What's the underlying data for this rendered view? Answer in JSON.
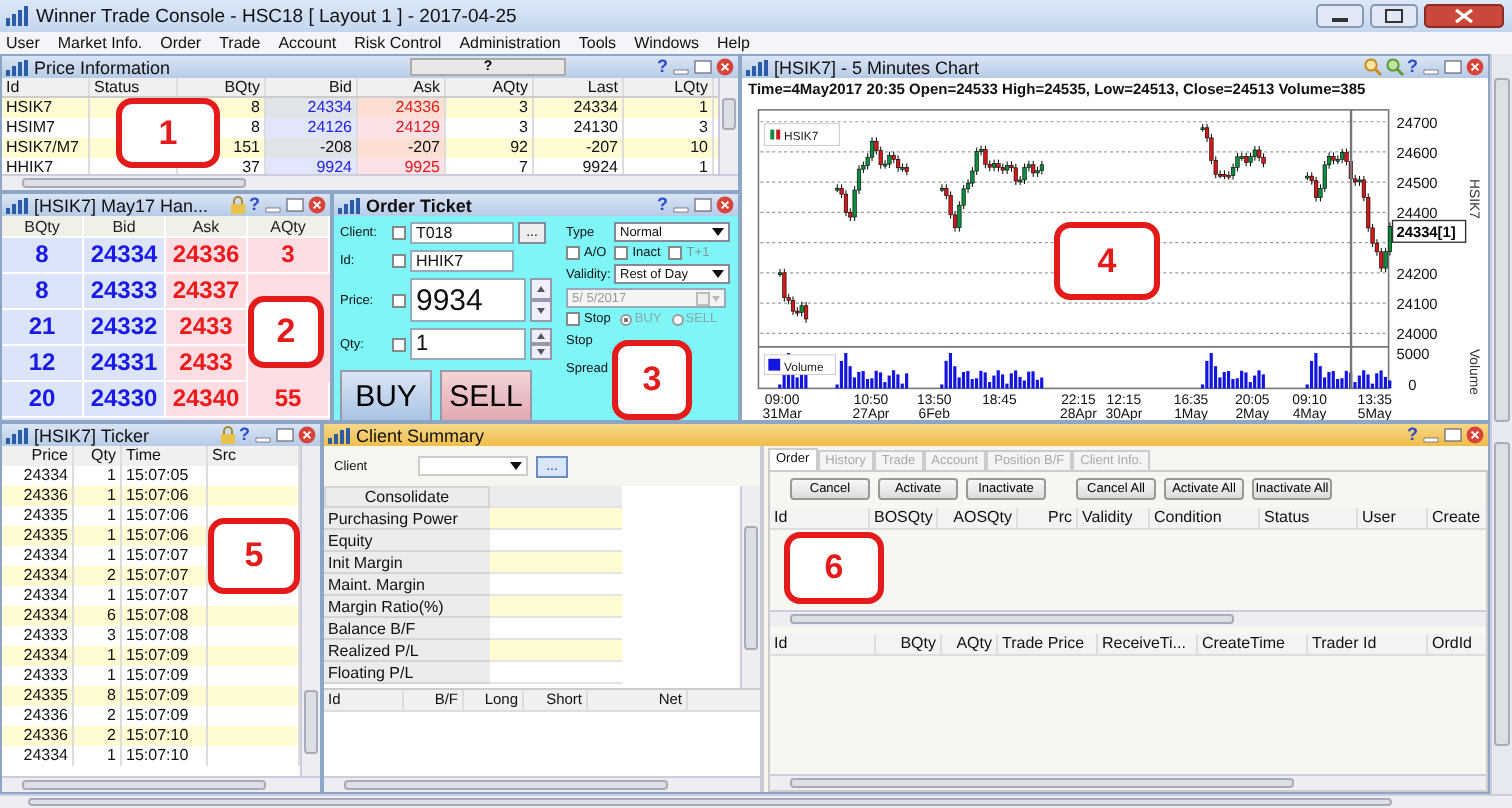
{
  "window": {
    "title": "Winner Trade Console - HSC18 [ Layout 1 ] - 2017-04-25"
  },
  "menu": [
    "User",
    "Market Info.",
    "Order",
    "Trade",
    "Account",
    "Risk Control",
    "Administration",
    "Tools",
    "Windows",
    "Help"
  ],
  "price_information": {
    "title": "Price Information",
    "help_button": "?",
    "help": "?",
    "columns": [
      "Id",
      "Status",
      "BQty",
      "Bid",
      "Ask",
      "AQty",
      "Last",
      "LQty"
    ],
    "rows": [
      {
        "kind": "outright",
        "id": "HSIK7",
        "bqty": "8",
        "bid": "24334",
        "ask": "24336",
        "aqty": "3",
        "last": "24334",
        "lqty": "1"
      },
      {
        "kind": "outright",
        "id": "HSIM7",
        "bqty": "8",
        "bid": "24126",
        "ask": "24129",
        "aqty": "3",
        "last": "24130",
        "lqty": "3"
      },
      {
        "kind": "spread",
        "id": "HSIK7/M7",
        "bqty": "151",
        "bid": "-208",
        "ask": "-207",
        "aqty": "92",
        "last": "-207",
        "lqty": "10"
      },
      {
        "kind": "outright",
        "id": "HHIK7",
        "bqty": "37",
        "bid": "9924",
        "ask": "9925",
        "aqty": "7",
        "last": "9924",
        "lqty": "1"
      }
    ]
  },
  "market_depth": {
    "title": "[HSIK7] May17 Han...",
    "help": "?",
    "columns": [
      "BQty",
      "Bid",
      "Ask",
      "AQty"
    ],
    "rows": [
      {
        "bqty": "8",
        "bid": "24334",
        "ask": "24336",
        "aqty": "3"
      },
      {
        "bqty": "8",
        "bid": "24333",
        "ask": "24337"
      },
      {
        "bqty": "21",
        "bid": "24332",
        "ask": "2433"
      },
      {
        "bqty": "12",
        "bid": "24331",
        "ask": "2433"
      },
      {
        "bqty": "20",
        "bid": "24330",
        "ask": "24340",
        "aqty": "55"
      }
    ]
  },
  "order_ticket": {
    "title": "Order Ticket",
    "help": "?",
    "client": {
      "label": "Client:",
      "value": "T018",
      "checked": false
    },
    "browse_button": "...",
    "id": {
      "label": "Id:",
      "value": "HHIK7",
      "checked": false
    },
    "price": {
      "label": "Price:",
      "value": "9934",
      "checked": false
    },
    "qty": {
      "label": "Qty:",
      "value": "1",
      "checked": false
    },
    "type": {
      "label": "Type",
      "value": "Normal"
    },
    "options": [
      {
        "label": "A/O",
        "checked": false,
        "disabled": false
      },
      {
        "label": "Inact",
        "checked": false,
        "disabled": false
      },
      {
        "label": "T+1",
        "checked": false,
        "disabled": true
      }
    ],
    "validity": {
      "label": "Validity:",
      "value": "Rest of Day"
    },
    "date": {
      "value": "5/ 5/2017",
      "disabled": true
    },
    "stop": {
      "label": "Stop",
      "checked": false
    },
    "sides": [
      {
        "label": "BUY",
        "selected": true,
        "disabled": true
      },
      {
        "label": "SELL",
        "selected": false,
        "disabled": true
      }
    ],
    "stop_label": "Stop",
    "spread_label": "Spread",
    "buy_button": "BUY",
    "sell_button": "SELL"
  },
  "chart": {
    "title": "[HSIK7] - 5 Minutes Chart",
    "help": "?",
    "info": "Time=4May2017 20:35 Open=24533 High=24535, Low=24513, Close=24513 Volume=385",
    "legend": "HSIK7",
    "volume_legend": "Volume",
    "price_ticks": [
      "24700",
      "24600",
      "24500",
      "24400",
      "24200",
      "24100",
      "24000"
    ],
    "volume_ticks": [
      "5000",
      "0"
    ],
    "time_labels": [
      {
        "time": "09:00",
        "date": "31Mar"
      },
      {
        "time": "10:50",
        "date": "27Apr"
      },
      {
        "time": "13:50",
        "date": "6Feb"
      },
      {
        "time": "18:45"
      },
      {
        "time": "22:15",
        "date": "28Apr"
      },
      {
        "time": "12:15",
        "date": "30Apr"
      },
      {
        "time": "16:35",
        "date": "1May"
      },
      {
        "time": "20:05",
        "date": "2May"
      },
      {
        "time": "09:10",
        "date": "4May"
      },
      {
        "time": "13:35",
        "date": "5May"
      }
    ],
    "last_price": "24334[1]",
    "axis_title": "HSIK7",
    "volume_axis_title": "Volume"
  },
  "ticker": {
    "title": "[HSIK7] Ticker",
    "help": "?",
    "columns": [
      "Price",
      "Qty",
      "Time",
      "Src"
    ],
    "rows": [
      {
        "price": "24334",
        "qty": "1",
        "time": "15:07:05"
      },
      {
        "price": "24336",
        "qty": "1",
        "time": "15:07:06"
      },
      {
        "price": "24335",
        "qty": "1",
        "time": "15:07:06"
      },
      {
        "price": "24335",
        "qty": "1",
        "time": "15:07:06"
      },
      {
        "price": "24334",
        "qty": "1",
        "time": "15:07:07"
      },
      {
        "price": "24334",
        "qty": "2",
        "time": "15:07:07"
      },
      {
        "price": "24334",
        "qty": "1",
        "time": "15:07:07"
      },
      {
        "price": "24334",
        "qty": "6",
        "time": "15:07:08"
      },
      {
        "price": "24333",
        "qty": "3",
        "time": "15:07:08"
      },
      {
        "price": "24334",
        "qty": "1",
        "time": "15:07:09"
      },
      {
        "price": "24333",
        "qty": "1",
        "time": "15:07:09"
      },
      {
        "price": "24335",
        "qty": "8",
        "time": "15:07:09"
      },
      {
        "price": "24336",
        "qty": "2",
        "time": "15:07:09"
      },
      {
        "price": "24336",
        "qty": "2",
        "time": "15:07:10"
      },
      {
        "price": "24334",
        "qty": "1",
        "time": "15:07:10"
      }
    ]
  },
  "client_summary": {
    "title": "Client Summary",
    "help": "?",
    "client_label": "Client",
    "browse_button": "...",
    "consolidate": {
      "header": "Consolidate",
      "rows": [
        "Purchasing Power",
        "Equity",
        "Init Margin",
        "Maint. Margin",
        "Margin Ratio(%)",
        "Balance B/F",
        "Realized P/L",
        "Floating P/L"
      ]
    },
    "position_columns": [
      "Id",
      "B/F",
      "Long",
      "Short",
      "Net"
    ],
    "tabs": [
      {
        "label": "Order",
        "selected": true
      },
      {
        "label": "History",
        "selected": false
      },
      {
        "label": "Trade",
        "selected": false
      },
      {
        "label": "Account",
        "selected": false
      },
      {
        "label": "Position B/F",
        "selected": false
      },
      {
        "label": "Client Info.",
        "selected": false
      }
    ],
    "buttons": [
      "Cancel",
      "Activate",
      "Inactivate",
      "Cancel All",
      "Activate All",
      "Inactivate All"
    ],
    "order_columns": [
      "Id",
      "BOSQty",
      "AOSQty",
      "Prc",
      "Validity",
      "Condition",
      "Status",
      "User",
      "Create"
    ],
    "trade_columns": [
      "Id",
      "BQty",
      "AQty",
      "Trade Price",
      "ReceiveTi...",
      "CreateTime",
      "Trader Id",
      "OrdId"
    ]
  },
  "callouts": [
    {
      "label": "1"
    },
    {
      "label": "2"
    },
    {
      "label": "3"
    },
    {
      "label": "4"
    },
    {
      "label": "5"
    },
    {
      "label": "6"
    }
  ]
}
